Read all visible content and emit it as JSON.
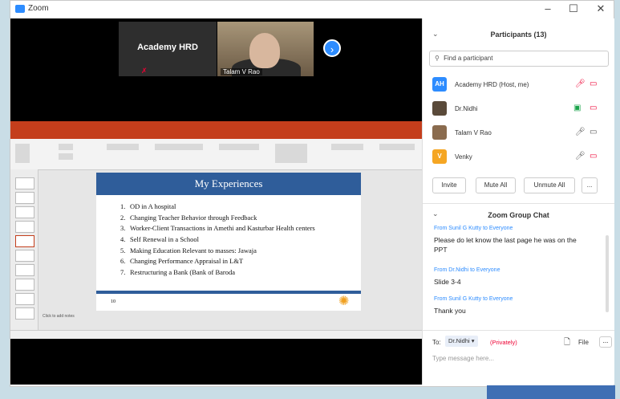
{
  "window": {
    "title": "Zoom",
    "minimize": "–",
    "maximize": "☐",
    "close": "✕"
  },
  "video": {
    "tile1_name": "Academy HRD",
    "tile2_name": "Talam V Rao",
    "next_arrow": "›"
  },
  "slide": {
    "title": "My Experiences",
    "items": [
      {
        "num": "1.",
        "text": "OD in A hospital"
      },
      {
        "num": "2.",
        "text": "Changing Teacher Behavior through Feedback"
      },
      {
        "num": "3.",
        "text": "Worker-Client Transactions in Amethi and Kasturbar Health centers"
      },
      {
        "num": "4.",
        "text": "Self Renewal in a School"
      },
      {
        "num": "5.",
        "text": "Making Education Relevant to masses: Jawaja"
      },
      {
        "num": "6.",
        "text": "Changing Performance Appraisal in L&T"
      },
      {
        "num": "7.",
        "text": "Restructuring a Bank (Bank of Baroda"
      }
    ],
    "page_number": "10",
    "notes_placeholder": "Click to add notes"
  },
  "participants": {
    "header": "Participants (13)",
    "search_placeholder": "Find a participant",
    "list": [
      {
        "initials": "AH",
        "name": "Academy HRD (Host, me)",
        "color": "#2d8cff"
      },
      {
        "initials": "",
        "name": "Dr.Nidhi",
        "color": "#5a4a3a"
      },
      {
        "initials": "",
        "name": "Talam V Rao",
        "color": "#8a6b4e"
      },
      {
        "initials": "V",
        "name": "Venky",
        "color": "#f5a623"
      }
    ],
    "invite": "Invite",
    "mute_all": "Mute All",
    "unmute_all": "Unmute All",
    "more": "..."
  },
  "chat": {
    "header": "Zoom Group Chat",
    "messages": [
      {
        "from": "From Sunil G Kutty to Everyone",
        "text": "Please do let know the last page he was on the PPT"
      },
      {
        "from": "From Dr.Nidhi to Everyone",
        "text": "Slide 3-4"
      },
      {
        "from": "From Sunil G Kutty to Everyone",
        "text": "Thank you"
      }
    ],
    "to_label": "To:",
    "recipient": "Dr.Nidhi ▾",
    "privately": "(Privately)",
    "file": "File",
    "more": "...",
    "input_placeholder": "Type message here..."
  }
}
